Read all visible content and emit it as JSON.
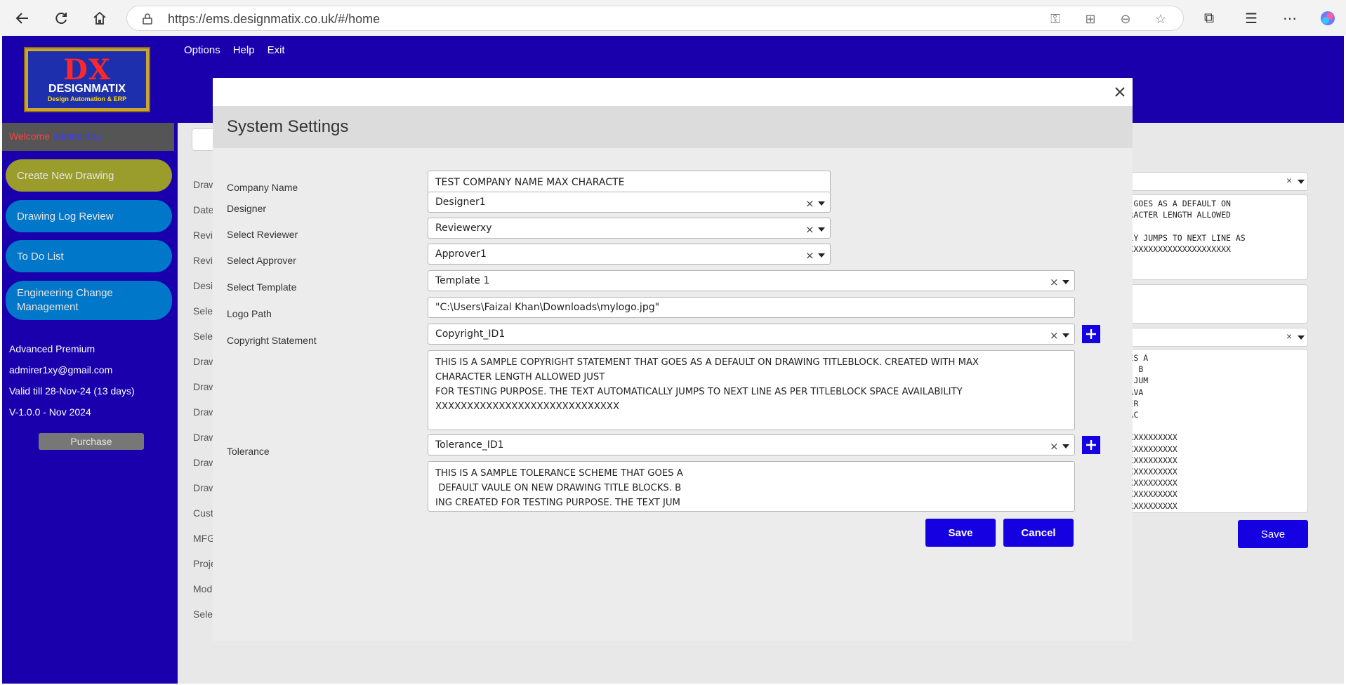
{
  "browser": {
    "url": "https://ems.designmatix.co.uk/#/home"
  },
  "header": {
    "logo": {
      "mark": "DX",
      "name": "DESIGNMATIX",
      "tagline": "Design Automation & ERP"
    },
    "menu": [
      "Options",
      "Help",
      "Exit"
    ]
  },
  "sidebar": {
    "welcome_label": "Welcome",
    "username": "admirer1xy",
    "buttons": [
      "Create New Drawing",
      "Drawing Log Review",
      "To Do List",
      "Engineering Change Management"
    ],
    "plan": "Advanced Premium",
    "email": "admirer1xy@gmail.com",
    "validity": "Valid till 28-Nov-24 (13 days)",
    "version": "V-1.0.0 - Nov 2024",
    "purchase_label": "Purchase"
  },
  "background": {
    "left_labels": [
      "Draw",
      "Date",
      "Revis",
      "Revis",
      "Desig",
      "Selec",
      "Selec",
      "Draw",
      "Draw",
      "Draw",
      "Draw",
      "Draw",
      "Draw",
      "Cust",
      "MFG",
      "Proje",
      "Mod",
      "Selec"
    ],
    "copyright_text": "T THAT GOES AS A DEFAULT ON\nAX CHARACTER LENGTH ALLOWED\n\nATICALLY JUMPS TO NEXT LINE AS\nXXXXXXXXXXXXXXXXXXXXXXXXXXX",
    "tolerance_text": "HAT GOES A\nBLOCKS. B\nE TEXT JUM\nSPACE AVA\nHARACTER\nE CHARAC\nXXXXXX\nXXXXXXXXXXXXXXXX\nXXXXXXXXXXXXXXXX\nXXXXXXXXXXXXXXXX\nXXXXXXXXXXXXXXXX\nXXXXXXXXXXXXXXXX\nXXXXXXXXXXXXXXXX\nXXXXXXXXXXXXXXXX",
    "save_label": "Save"
  },
  "modal": {
    "title": "System Settings",
    "fields": {
      "company_name": {
        "label": "Company Name",
        "value": "TEST COMPANY NAME MAX CHARACTE"
      },
      "designer": {
        "label": "Designer",
        "value": "Designer1"
      },
      "reviewer": {
        "label": "Select Reviewer",
        "value": "Reviewerxy"
      },
      "approver": {
        "label": "Select Approver",
        "value": "Approver1"
      },
      "template": {
        "label": "Select Template",
        "value": "Template 1"
      },
      "logo_path": {
        "label": "Logo Path",
        "value": "\"C:\\Users\\Faizal Khan\\Downloads\\mylogo.jpg\""
      },
      "copyright": {
        "label": "Copyright Statement",
        "value": "Copyright_ID1",
        "text": "THIS IS A SAMPLE COPYRIGHT STATEMENT THAT GOES AS A DEFAULT ON DRAWING TITLEBLOCK. CREATED WITH MAX\nCHARACTER LENGTH ALLOWED JUST\nFOR TESTING PURPOSE. THE TEXT AUTOMATICALLY JUMPS TO NEXT LINE AS PER TITLEBLOCK SPACE AVAILABILITY\nXXXXXXXXXXXXXXXXXXXXXXXXXXXXX"
      },
      "tolerance": {
        "label": "Tolerance",
        "value": "Tolerance_ID1",
        "text": "THIS IS A SAMPLE TOLERANCE SCHEME THAT GOES A\n DEFAULT VAULE ON NEW DRAWING TITLE BLOCKS. B\nING CREATED FOR TESTING PURPOSE. THE TEXT JUM"
      }
    },
    "save_label": "Save",
    "cancel_label": "Cancel"
  },
  "colors": {
    "brand_blue": "#1a00ad",
    "button_blue": "#1400e0",
    "sidebar_button": "#0077c8",
    "sidebar_button_active": "#9a9c2c"
  }
}
